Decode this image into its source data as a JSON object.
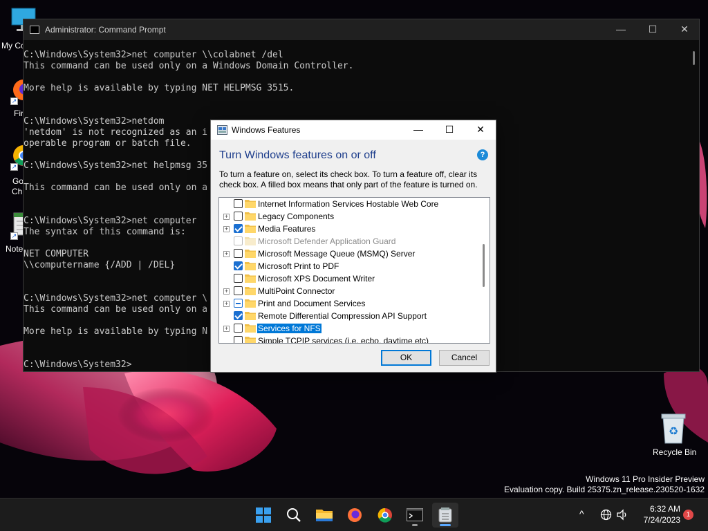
{
  "desktop": {
    "icons": [
      {
        "label": "My Co"
      },
      {
        "label": "Fir"
      },
      {
        "label": "Go"
      },
      {
        "label": "Ch"
      },
      {
        "label": "Note"
      }
    ],
    "recycle_bin_label": "Recycle Bin",
    "watermark": {
      "line1": "Windows 11 Pro Insider Preview",
      "line2": "Evaluation copy. Build 25375.zn_release.230520-1632"
    },
    "accent_color": "#0078d7"
  },
  "cmd": {
    "title": "Administrator: Command Prompt",
    "controls": {
      "minimize": "—",
      "maximize": "☐",
      "close": "✕"
    },
    "lines": [
      "C:\\Windows\\System32>net computer \\\\colabnet /del",
      "This command can be used only on a Windows Domain Controller.",
      "",
      "More help is available by typing NET HELPMSG 3515.",
      "",
      "",
      "C:\\Windows\\System32>netdom",
      "'netdom' is not recognized as an i",
      "operable program or batch file.",
      "",
      "C:\\Windows\\System32>net helpmsg 35",
      "",
      "This command can be used only on a",
      "",
      "",
      "C:\\Windows\\System32>net computer",
      "The syntax of this command is:",
      "",
      "NET COMPUTER",
      "\\\\computername {/ADD | /DEL}",
      "",
      "",
      "C:\\Windows\\System32>net computer \\",
      "This command can be used only on a",
      "",
      "More help is available by typing N",
      "",
      "",
      "C:\\Windows\\System32>"
    ]
  },
  "features_dialog": {
    "title": "Windows Features",
    "controls": {
      "minimize": "—",
      "maximize": "☐",
      "close": "✕"
    },
    "heading": "Turn Windows features on or off",
    "help_glyph": "?",
    "description": "To turn a feature on, select its check box. To turn a feature off, clear its check box. A filled box means that only part of the feature is turned on.",
    "items": [
      {
        "label": "Internet Information Services Hostable Web Core",
        "state": "unchecked",
        "expandable": false,
        "disabled": false,
        "selected": false
      },
      {
        "label": "Legacy Components",
        "state": "unchecked",
        "expandable": true,
        "disabled": false,
        "selected": false
      },
      {
        "label": "Media Features",
        "state": "checked",
        "expandable": true,
        "disabled": false,
        "selected": false
      },
      {
        "label": "Microsoft Defender Application Guard",
        "state": "unchecked",
        "expandable": false,
        "disabled": true,
        "selected": false
      },
      {
        "label": "Microsoft Message Queue (MSMQ) Server",
        "state": "unchecked",
        "expandable": true,
        "disabled": false,
        "selected": false
      },
      {
        "label": "Microsoft Print to PDF",
        "state": "checked",
        "expandable": false,
        "disabled": false,
        "selected": false
      },
      {
        "label": "Microsoft XPS Document Writer",
        "state": "unchecked",
        "expandable": false,
        "disabled": false,
        "selected": false
      },
      {
        "label": "MultiPoint Connector",
        "state": "unchecked",
        "expandable": true,
        "disabled": false,
        "selected": false
      },
      {
        "label": "Print and Document Services",
        "state": "partial",
        "expandable": true,
        "disabled": false,
        "selected": false
      },
      {
        "label": "Remote Differential Compression API Support",
        "state": "checked",
        "expandable": false,
        "disabled": false,
        "selected": false
      },
      {
        "label": "Services for NFS",
        "state": "unchecked",
        "expandable": true,
        "disabled": false,
        "selected": true
      },
      {
        "label": "Simple TCPIP services (i.e. echo, daytime etc)",
        "state": "unchecked",
        "expandable": false,
        "disabled": false,
        "selected": false
      }
    ],
    "ok_label": "OK",
    "cancel_label": "Cancel"
  },
  "taskbar": {
    "apps": [
      {
        "name": "start-button-icon"
      },
      {
        "name": "search-icon"
      },
      {
        "name": "file-explorer-icon"
      },
      {
        "name": "firefox-icon"
      },
      {
        "name": "chrome-icon"
      },
      {
        "name": "terminal-icon"
      },
      {
        "name": "windows-features-icon"
      }
    ],
    "tray_chevron": "^",
    "time": "6:32 AM",
    "date": "7/24/2023",
    "notification_count": "1"
  }
}
